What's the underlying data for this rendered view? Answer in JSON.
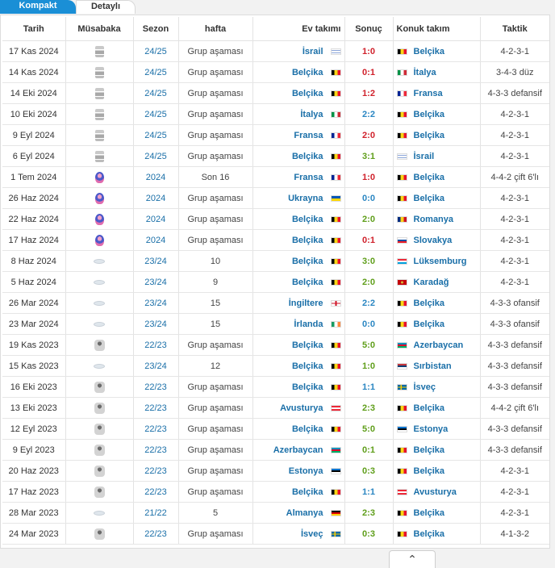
{
  "tabs": {
    "compact": "Kompakt",
    "detailed": "Detaylı"
  },
  "headers": {
    "date": "Tarih",
    "competition": "Müsabaka",
    "season": "Sezon",
    "round": "hafta",
    "home": "Ev takımı",
    "score": "Sonuç",
    "away": "Konuk takım",
    "tactic": "Taktik"
  },
  "flag_colors": {
    "Belçika": [
      "#000000",
      "#f9d616",
      "#e8112d"
    ],
    "İsrail": [
      "#ffffff",
      "#1a4db3",
      "#ffffff"
    ],
    "İtalya": [
      "#009246",
      "#ffffff",
      "#ce2b37"
    ],
    "Fransa": [
      "#002395",
      "#ffffff",
      "#ed2939"
    ],
    "Ukrayna": [
      "#0057b7",
      "#ffd700"
    ],
    "Romanya": [
      "#002b7f",
      "#fcd116",
      "#ce1126"
    ],
    "Slovakya": [
      "#ffffff",
      "#0b4ea2",
      "#ee1c25"
    ],
    "Lüksemburg": [
      "#ed2939",
      "#ffffff",
      "#00a1de"
    ],
    "Karadağ": [
      "#c40308",
      "#d4af37",
      "#c40308"
    ],
    "İngiltere": [
      "#ffffff",
      "#ce1124",
      "#ffffff"
    ],
    "İrlanda": [
      "#169b62",
      "#ffffff",
      "#ff883e"
    ],
    "Azerbaycan": [
      "#0092bc",
      "#e4002b",
      "#00af66"
    ],
    "Sırbistan": [
      "#c6363c",
      "#0c4076",
      "#ffffff"
    ],
    "İsveç": [
      "#006aa7",
      "#fecc00",
      "#006aa7"
    ],
    "Avusturya": [
      "#ed2939",
      "#ffffff",
      "#ed2939"
    ],
    "Estonya": [
      "#0072ce",
      "#000000",
      "#ffffff"
    ],
    "Almanya": [
      "#000000",
      "#dd0000",
      "#ffce00"
    ]
  },
  "matches": [
    {
      "date": "17 Kas 2024",
      "comp": "nations-league-icon",
      "season": "24/25",
      "round": "Grup aşaması",
      "home": "İsrail",
      "score": "1:0",
      "result": "loss",
      "away": "Belçika",
      "tactic": "4-2-3-1"
    },
    {
      "date": "14 Kas 2024",
      "comp": "nations-league-icon",
      "season": "24/25",
      "round": "Grup aşaması",
      "home": "Belçika",
      "score": "0:1",
      "result": "loss",
      "away": "İtalya",
      "tactic": "3-4-3 düz"
    },
    {
      "date": "14 Eki 2024",
      "comp": "nations-league-icon",
      "season": "24/25",
      "round": "Grup aşaması",
      "home": "Belçika",
      "score": "1:2",
      "result": "loss",
      "away": "Fransa",
      "tactic": "4-3-3 defansif"
    },
    {
      "date": "10 Eki 2024",
      "comp": "nations-league-icon",
      "season": "24/25",
      "round": "Grup aşaması",
      "home": "İtalya",
      "score": "2:2",
      "result": "draw",
      "away": "Belçika",
      "tactic": "4-2-3-1"
    },
    {
      "date": "9 Eyl 2024",
      "comp": "nations-league-icon",
      "season": "24/25",
      "round": "Grup aşaması",
      "home": "Fransa",
      "score": "2:0",
      "result": "loss",
      "away": "Belçika",
      "tactic": "4-2-3-1"
    },
    {
      "date": "6 Eyl 2024",
      "comp": "nations-league-icon",
      "season": "24/25",
      "round": "Grup aşaması",
      "home": "Belçika",
      "score": "3:1",
      "result": "win",
      "away": "İsrail",
      "tactic": "4-2-3-1"
    },
    {
      "date": "1 Tem 2024",
      "comp": "euro-icon",
      "season": "2024",
      "round": "Son 16",
      "home": "Fransa",
      "score": "1:0",
      "result": "loss",
      "away": "Belçika",
      "tactic": "4-4-2 çift 6'lı"
    },
    {
      "date": "26 Haz 2024",
      "comp": "euro-icon",
      "season": "2024",
      "round": "Grup aşaması",
      "home": "Ukrayna",
      "score": "0:0",
      "result": "draw",
      "away": "Belçika",
      "tactic": "4-2-3-1"
    },
    {
      "date": "22 Haz 2024",
      "comp": "euro-icon",
      "season": "2024",
      "round": "Grup aşaması",
      "home": "Belçika",
      "score": "2:0",
      "result": "win",
      "away": "Romanya",
      "tactic": "4-2-3-1"
    },
    {
      "date": "17 Haz 2024",
      "comp": "euro-icon",
      "season": "2024",
      "round": "Grup aşaması",
      "home": "Belçika",
      "score": "0:1",
      "result": "loss",
      "away": "Slovakya",
      "tactic": "4-2-3-1"
    },
    {
      "date": "8 Haz 2024",
      "comp": "friendly-icon",
      "season": "23/24",
      "round": "10",
      "home": "Belçika",
      "score": "3:0",
      "result": "win",
      "away": "Lüksemburg",
      "tactic": "4-2-3-1"
    },
    {
      "date": "5 Haz 2024",
      "comp": "friendly-icon",
      "season": "23/24",
      "round": "9",
      "home": "Belçika",
      "score": "2:0",
      "result": "win",
      "away": "Karadağ",
      "tactic": "4-2-3-1"
    },
    {
      "date": "26 Mar 2024",
      "comp": "friendly-icon",
      "season": "23/24",
      "round": "15",
      "home": "İngiltere",
      "score": "2:2",
      "result": "draw",
      "away": "Belçika",
      "tactic": "4-3-3 ofansif"
    },
    {
      "date": "23 Mar 2024",
      "comp": "friendly-icon",
      "season": "23/24",
      "round": "15",
      "home": "İrlanda",
      "score": "0:0",
      "result": "draw",
      "away": "Belçika",
      "tactic": "4-3-3 ofansif"
    },
    {
      "date": "19 Kas 2023",
      "comp": "euro-qualifying-icon",
      "season": "22/23",
      "round": "Grup aşaması",
      "home": "Belçika",
      "score": "5:0",
      "result": "win",
      "away": "Azerbaycan",
      "tactic": "4-3-3 defansif"
    },
    {
      "date": "15 Kas 2023",
      "comp": "friendly-icon",
      "season": "23/24",
      "round": "12",
      "home": "Belçika",
      "score": "1:0",
      "result": "win",
      "away": "Sırbistan",
      "tactic": "4-3-3 defansif"
    },
    {
      "date": "16 Eki 2023",
      "comp": "euro-qualifying-icon",
      "season": "22/23",
      "round": "Grup aşaması",
      "home": "Belçika",
      "score": "1:1",
      "result": "draw",
      "away": "İsveç",
      "tactic": "4-3-3 defansif"
    },
    {
      "date": "13 Eki 2023",
      "comp": "euro-qualifying-icon",
      "season": "22/23",
      "round": "Grup aşaması",
      "home": "Avusturya",
      "score": "2:3",
      "result": "win",
      "away": "Belçika",
      "tactic": "4-4-2 çift 6'lı"
    },
    {
      "date": "12 Eyl 2023",
      "comp": "euro-qualifying-icon",
      "season": "22/23",
      "round": "Grup aşaması",
      "home": "Belçika",
      "score": "5:0",
      "result": "win",
      "away": "Estonya",
      "tactic": "4-3-3 defansif"
    },
    {
      "date": "9 Eyl 2023",
      "comp": "euro-qualifying-icon",
      "season": "22/23",
      "round": "Grup aşaması",
      "home": "Azerbaycan",
      "score": "0:1",
      "result": "win",
      "away": "Belçika",
      "tactic": "4-3-3 defansif"
    },
    {
      "date": "20 Haz 2023",
      "comp": "euro-qualifying-icon",
      "season": "22/23",
      "round": "Grup aşaması",
      "home": "Estonya",
      "score": "0:3",
      "result": "win",
      "away": "Belçika",
      "tactic": "4-2-3-1"
    },
    {
      "date": "17 Haz 2023",
      "comp": "euro-qualifying-icon",
      "season": "22/23",
      "round": "Grup aşaması",
      "home": "Belçika",
      "score": "1:1",
      "result": "draw",
      "away": "Avusturya",
      "tactic": "4-2-3-1"
    },
    {
      "date": "28 Mar 2023",
      "comp": "friendly-icon",
      "season": "21/22",
      "round": "5",
      "home": "Almanya",
      "score": "2:3",
      "result": "win",
      "away": "Belçika",
      "tactic": "4-2-3-1"
    },
    {
      "date": "24 Mar 2023",
      "comp": "euro-qualifying-icon",
      "season": "22/23",
      "round": "Grup aşaması",
      "home": "İsveç",
      "score": "0:3",
      "result": "win",
      "away": "Belçika",
      "tactic": "4-1-3-2"
    }
  ],
  "bottom": {
    "icon": "chevron-up-icon"
  }
}
